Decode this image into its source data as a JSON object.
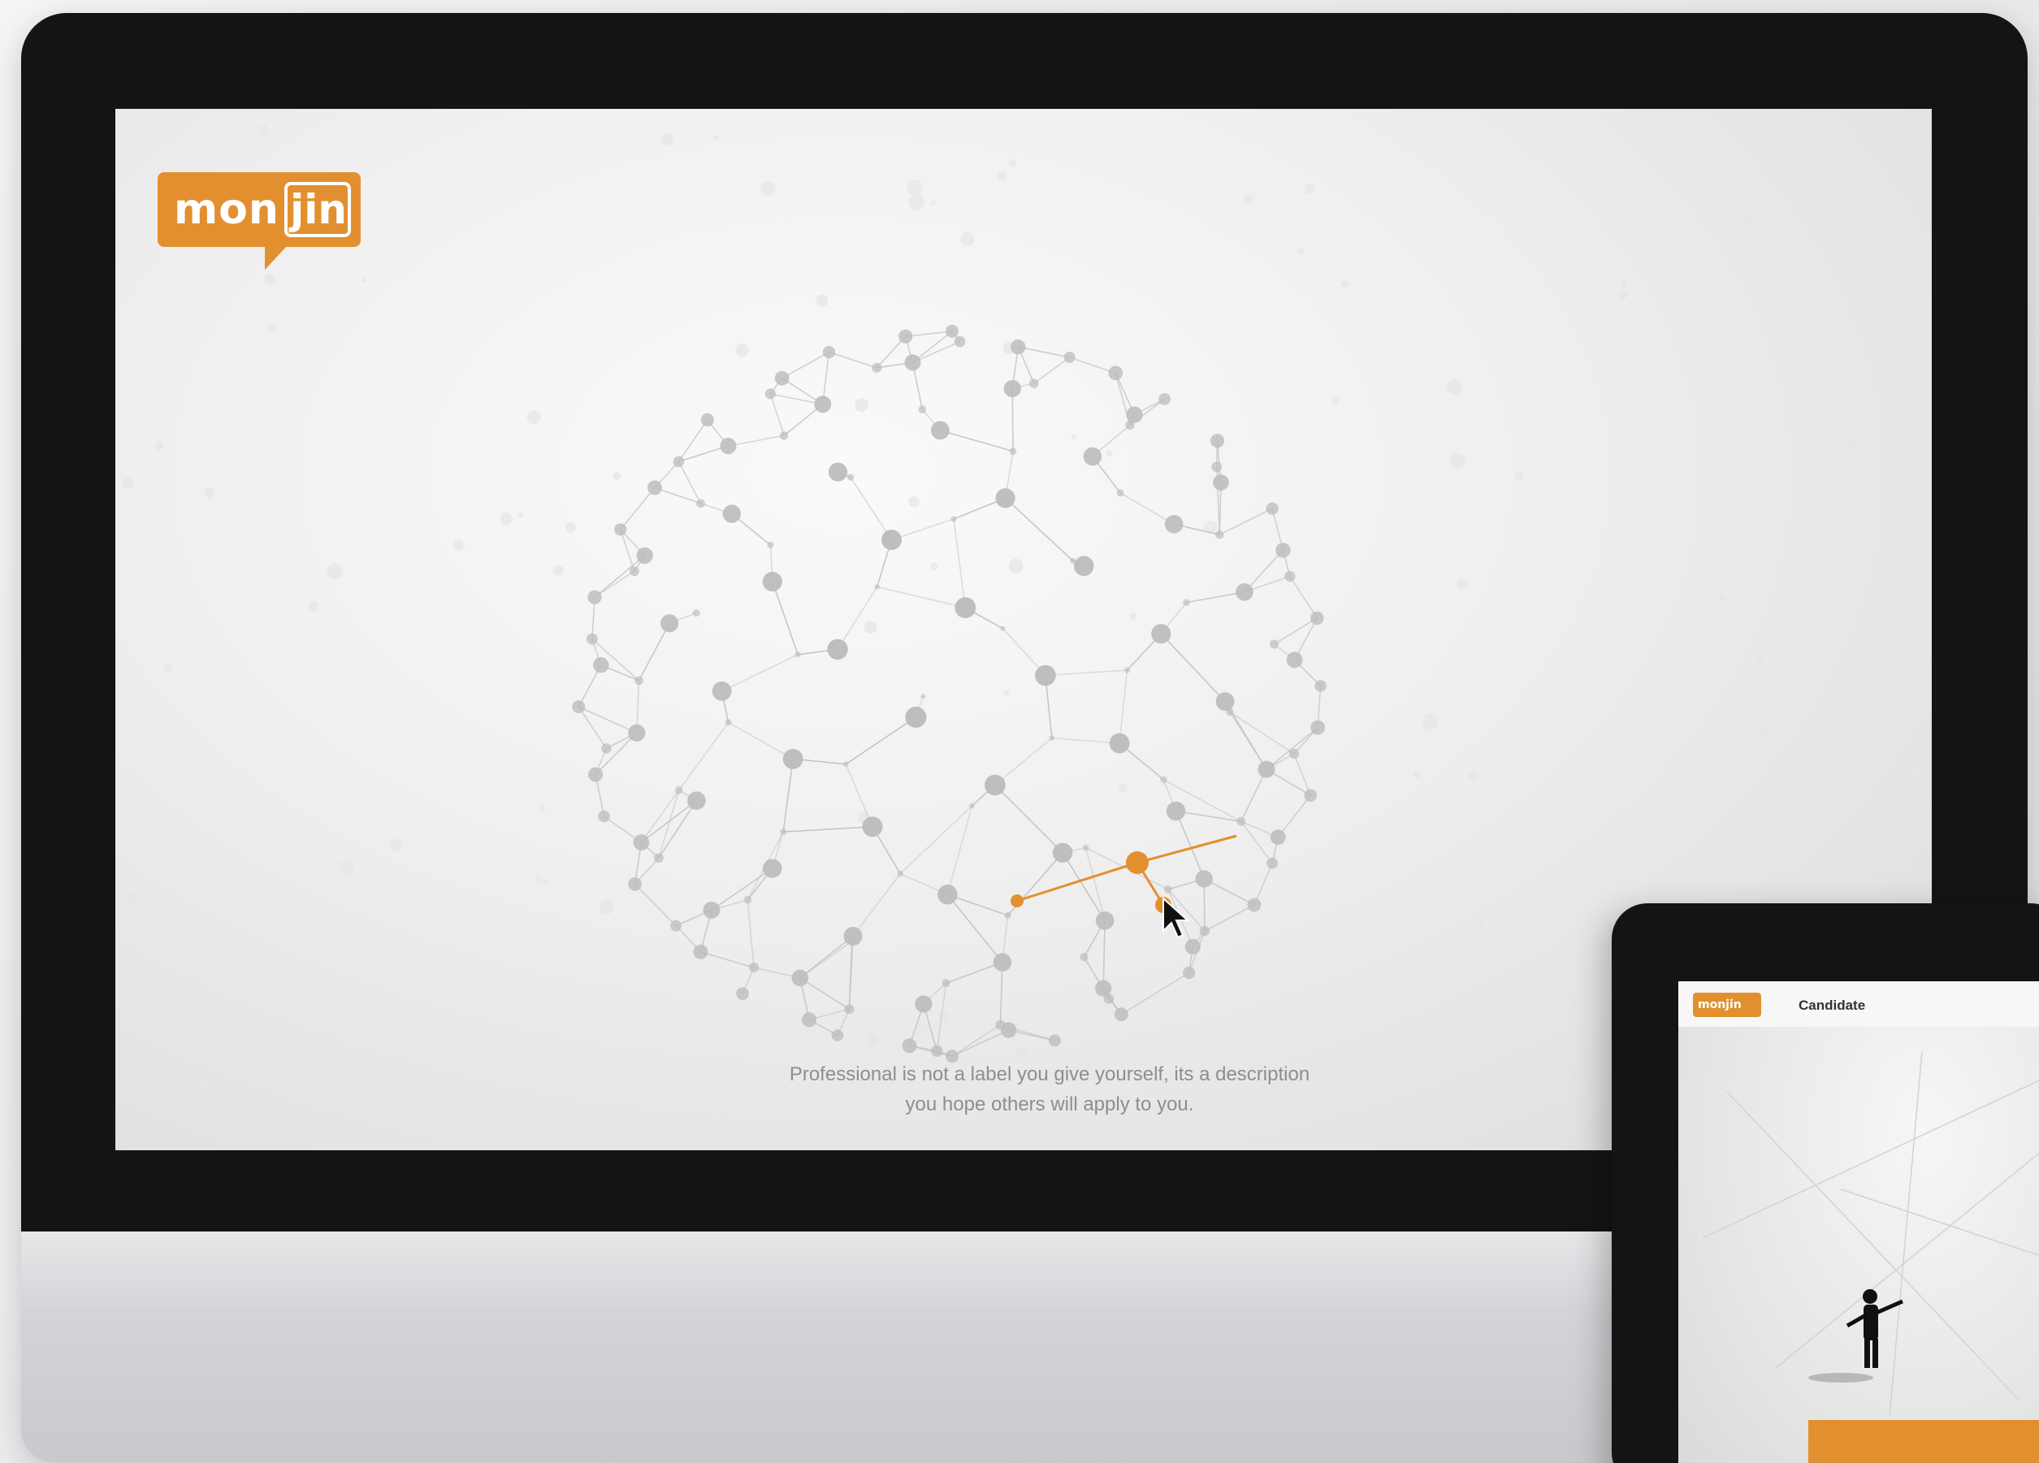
{
  "main_screen": {
    "logo": {
      "left": "mon",
      "right": "jin"
    },
    "quote_line1": "Professional is not a label you give yourself, its a description",
    "quote_line2": "you hope others will apply to you.",
    "cursor_icon": "arrow-cursor-icon"
  },
  "tablet": {
    "logo_text": "monjin",
    "tab_label": "Candidate"
  },
  "colors": {
    "brand_orange": "#e2902f",
    "bezel": "#141414",
    "globe_line": "#c4c4c4",
    "globe_node": "#bdbdbd",
    "quote_text": "#8e8e8e"
  }
}
